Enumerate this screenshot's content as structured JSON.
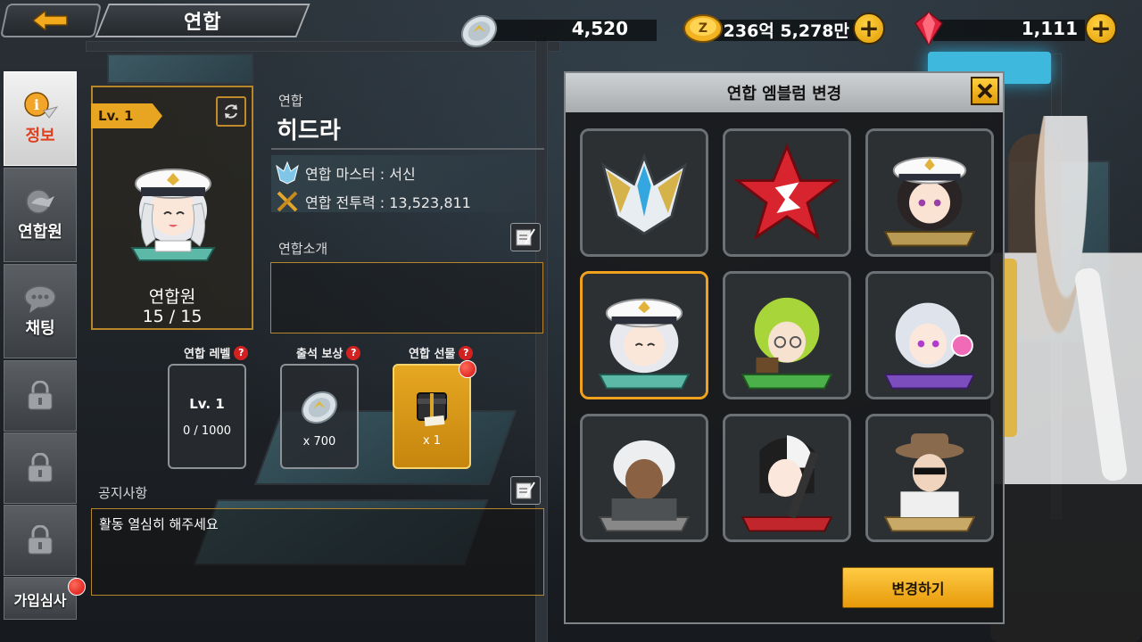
{
  "header": {
    "back_icon": "back-arrow-icon",
    "title": "연합"
  },
  "currencies": [
    {
      "name": "silver-coin",
      "value": "4,520",
      "icon": "silver-coin-icon"
    },
    {
      "name": "gold-coin",
      "value": "236억 5,278만",
      "icon": "gold-coin-icon"
    },
    {
      "name": "gem",
      "value": "1,111",
      "icon": "red-gem-icon"
    }
  ],
  "sidebar": {
    "items": [
      {
        "label": "정보",
        "icon": "info-icon",
        "active": true
      },
      {
        "label": "연합원",
        "icon": "members-icon"
      },
      {
        "label": "채팅",
        "icon": "chat-icon"
      },
      {
        "label": "",
        "icon": "lock-icon"
      },
      {
        "label": "",
        "icon": "lock-icon"
      },
      {
        "label": "",
        "icon": "lock-icon"
      },
      {
        "label": "가입심사",
        "icon": "",
        "badge": true
      }
    ]
  },
  "guild": {
    "level_tag": "Lv. 1",
    "members_label": "연합원",
    "members_count": "15 / 15",
    "sub_label": "연합",
    "name": "히드라",
    "master": "연합 마스터 : 서신",
    "power": "연합 전투력 : 13,523,811",
    "intro_label": "연합소개",
    "intro_text": "",
    "notice_label": "공지사항",
    "notice_text": "활동 열심히 해주세요"
  },
  "boxes": [
    {
      "label": "연합 레벨",
      "line1": "Lv. 1",
      "line2": "0 / 1000"
    },
    {
      "label": "출석 보상",
      "line1": "",
      "line2": "x 700"
    },
    {
      "label": "연합 선물",
      "line1": "",
      "line2": "x 1"
    }
  ],
  "modal": {
    "title": "연합 엠블럼 변경",
    "close_icon": "close-x-icon",
    "change_label": "변경하기",
    "emblems": [
      {
        "name": "wing-crest-emblem"
      },
      {
        "name": "red-star-emblem"
      },
      {
        "name": "dark-hair-captain-emblem"
      },
      {
        "name": "silver-hair-captain-emblem",
        "selected": true
      },
      {
        "name": "green-hair-emblem"
      },
      {
        "name": "lavender-hair-emblem"
      },
      {
        "name": "white-hair-soldier-emblem"
      },
      {
        "name": "black-white-gunner-emblem"
      },
      {
        "name": "fedora-gunman-emblem"
      }
    ]
  },
  "colors": {
    "accent_gold": "#e8a521",
    "frame_gold": "#b7862a",
    "alert_red": "#d40e0e"
  }
}
